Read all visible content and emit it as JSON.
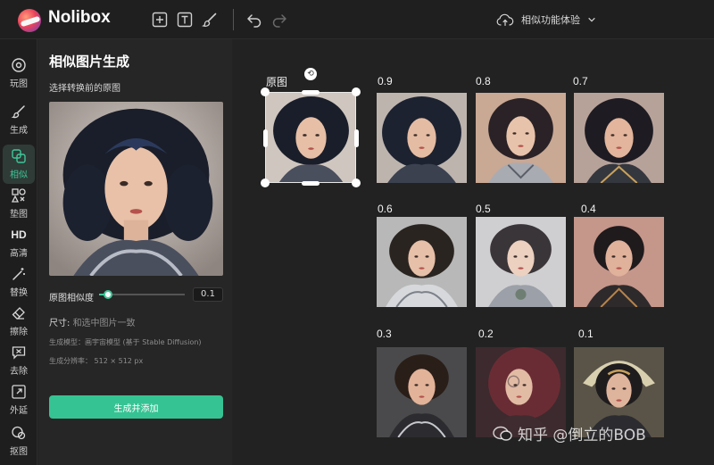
{
  "app": {
    "name": "Nolibox"
  },
  "toolbar": {
    "icons": [
      "add-frame-icon",
      "text-icon",
      "brush-icon",
      "undo-icon",
      "redo-icon"
    ],
    "feature_label": "相似功能体验"
  },
  "nav": {
    "items": [
      {
        "label": "玩图",
        "icon": "gallery-icon"
      },
      {
        "label": "生成",
        "icon": "brush-icon"
      },
      {
        "label": "相似",
        "icon": "similar-icon",
        "active": true
      },
      {
        "label": "垫图",
        "icon": "shapes-icon"
      },
      {
        "label": "高清",
        "icon_text": "HD"
      },
      {
        "label": "替换",
        "icon": "magic-wand-icon"
      },
      {
        "label": "擦除",
        "icon": "eraser-icon"
      },
      {
        "label": "去除",
        "icon": "remove-icon"
      },
      {
        "label": "外延",
        "icon": "expand-icon"
      },
      {
        "label": "抠图",
        "icon": "cutout-icon"
      }
    ]
  },
  "panel": {
    "title": "相似图片生成",
    "subtitle": "选择转换前的原图",
    "similarity_label": "原图相似度",
    "similarity_value": "0.1",
    "similarity_fraction": 0.1,
    "size_label": "尺寸:",
    "size_value": "和选中图片一致",
    "model_info": "生成模型：画宇宙模型 (基于 Stable Diffusion)",
    "resolution_info": "生成分辨率：  512 × 512 px",
    "generate_button": "生成并添加"
  },
  "canvas": {
    "original_label": "原图",
    "results": [
      {
        "label": "0.9"
      },
      {
        "label": "0.8"
      },
      {
        "label": "0.7"
      },
      {
        "label": "0.6"
      },
      {
        "label": "0.5"
      },
      {
        "label": "0.4"
      },
      {
        "label": "0.3"
      },
      {
        "label": "0.2"
      },
      {
        "label": "0.1"
      }
    ]
  },
  "watermark": {
    "text": "知乎 @倒立的BOB"
  },
  "colors": {
    "accent": "#36c393",
    "background": "#232323",
    "panel": "#262626"
  }
}
